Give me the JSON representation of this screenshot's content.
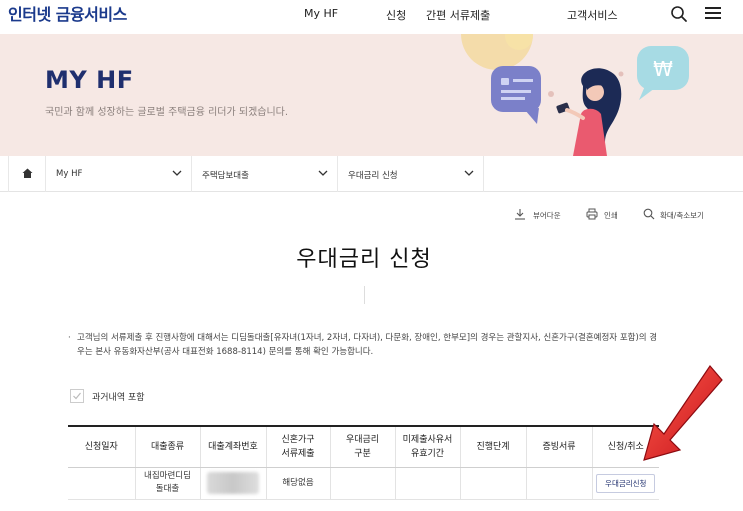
{
  "header": {
    "brand": "인터넷 금융서비스",
    "nav": [
      "My HF",
      "신청",
      "간편 서류제출",
      "고객서비스"
    ]
  },
  "banner": {
    "title": "MY HF",
    "subtitle": "국민과 함께 성장하는 글로벌 주택금융 리더가 되겠습니다.",
    "currency_symbol": "₩"
  },
  "breadcrumb": {
    "items": [
      "My HF",
      "주택담보대출",
      "우대금리 신청"
    ]
  },
  "toolbar": {
    "download": "뷰어다운",
    "print": "인쇄",
    "zoom": "확대/축소보기"
  },
  "page": {
    "title": "우대금리 신청",
    "notice_bullet": "·",
    "notice": "고객님의 서류제출 후 진행사항에 대해서는 디딤돌대출[유자녀(1자녀, 2자녀, 다자녀), 다문화, 장애인, 한부모]의 경우는 관할지사, 신혼가구(결혼예정자 포함)의 경우는 본사 유동화자산부(공사 대표전화 1688-8114) 문의를 통해 확인 가능합니다.",
    "history_label": "과거내역 포함"
  },
  "table": {
    "headers": [
      "신청일자",
      "대출종류",
      "대출계좌번호",
      "신혼가구\n서류제출",
      "우대금리\n구분",
      "미제출사유서\n유효기간",
      "진행단계",
      "증빙서류",
      "신청/취소"
    ],
    "row": {
      "date": "",
      "loan_type": "내집마련디딤\n돌대출",
      "newlywed": "해당없음",
      "rate_type": "",
      "expiry": "",
      "stage": "",
      "docs": "",
      "action": "우대금리신청"
    }
  },
  "colors": {
    "brand": "#1b3a8c",
    "banner_bg": "#f6e8e4",
    "arrow": "#e02020"
  }
}
